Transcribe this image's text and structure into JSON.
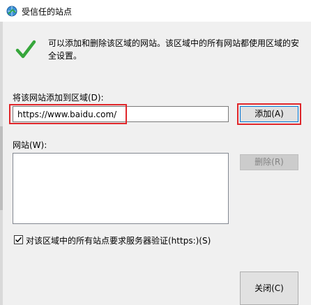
{
  "window": {
    "title": "受信任的站点"
  },
  "description": "可以添加和删除该区域的网站。该区域中的所有网站都使用区域的安全设置。",
  "add_section": {
    "label": "将该网站添加到区域(D):",
    "input_value": "https://www.baidu.com/",
    "add_button": "添加(A)"
  },
  "sites_section": {
    "label": "网站(W):",
    "items": [],
    "remove_button": "删除(R)"
  },
  "https_checkbox": {
    "label": "对该区域中的所有站点要求服务器验证(https:)(S)",
    "checked": true
  },
  "close_button": "关闭(C)",
  "colors": {
    "highlight": "#e0262a",
    "check_green": "#36a63b",
    "focus_border": "#0078d7"
  }
}
